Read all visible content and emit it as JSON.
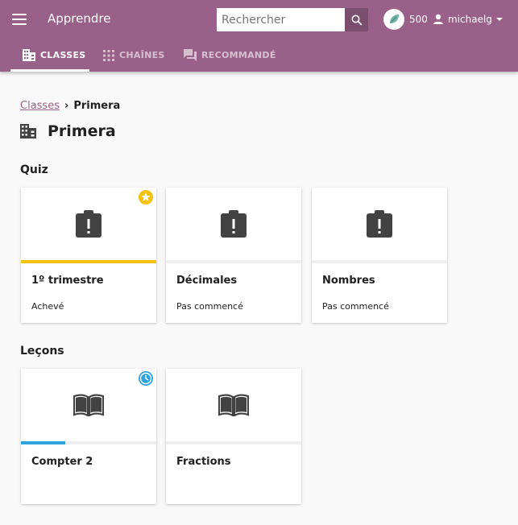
{
  "app": {
    "title": "Apprendre"
  },
  "search": {
    "placeholder": "Rechercher"
  },
  "points": {
    "value": "500"
  },
  "user": {
    "name": "michaelg"
  },
  "tabs": [
    {
      "label": "CLASSES",
      "active": true
    },
    {
      "label": "CHAÎNES",
      "active": false
    },
    {
      "label": "RECOMMANDÉ",
      "active": false
    }
  ],
  "breadcrumb": {
    "parent": "Classes",
    "separator": "›",
    "current": "Primera"
  },
  "page": {
    "title": "Primera"
  },
  "sections": {
    "quiz": {
      "title": "Quiz",
      "cards": [
        {
          "title": "1º trimestre",
          "status": "Achevé",
          "progress": 1.0,
          "badge": "star-icon"
        },
        {
          "title": "Décimales",
          "status": "Pas commencé",
          "progress": 0
        },
        {
          "title": "Nombres",
          "status": "Pas commencé",
          "progress": 0
        }
      ]
    },
    "lessons": {
      "title": "Leçons",
      "cards": [
        {
          "title": "Compter 2",
          "status": "",
          "progress": 0.33,
          "badge": "clock-icon"
        },
        {
          "title": "Fractions",
          "status": "",
          "progress": 0
        }
      ]
    }
  },
  "colors": {
    "appbar": "#996189",
    "accent": "#996189",
    "complete": "#f4c20d",
    "in_progress": "#2ea3e0"
  }
}
